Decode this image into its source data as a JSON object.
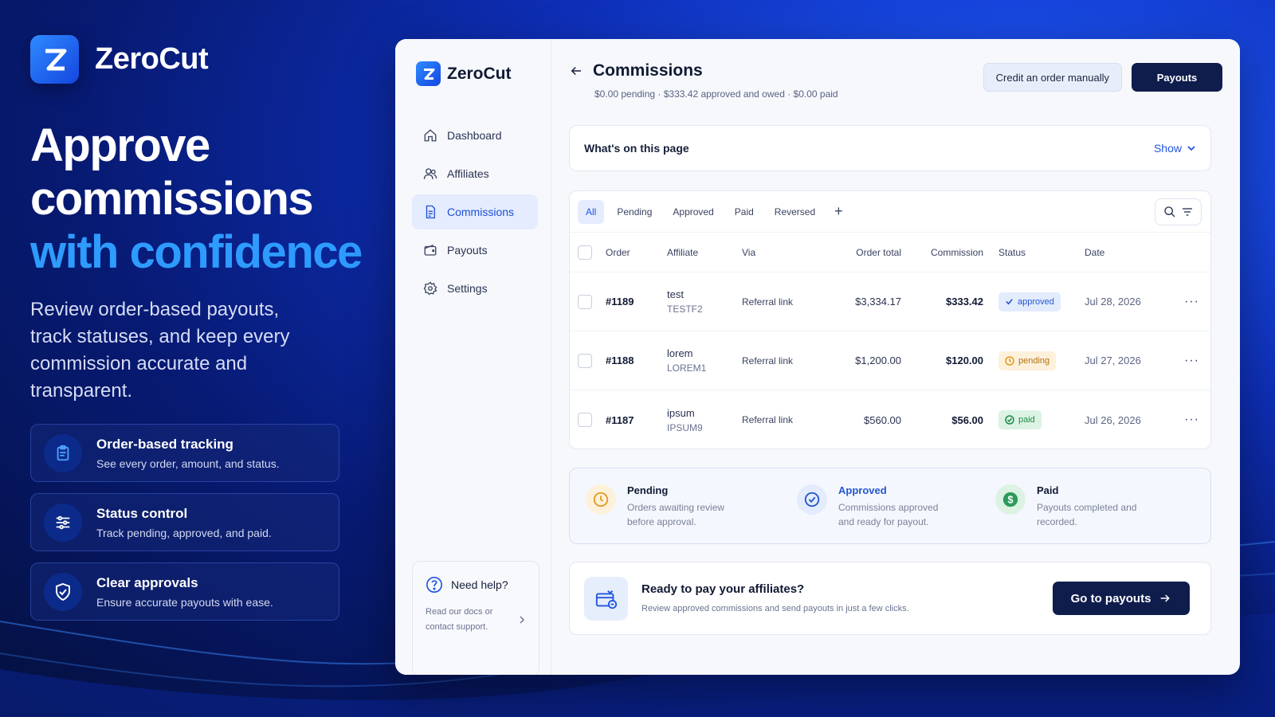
{
  "brand": {
    "name": "ZeroCut"
  },
  "hero": {
    "headline_line1": "Approve",
    "headline_line2": "commissions",
    "headline_highlight": "with confidence",
    "subtext": "Review order-based payouts, track statuses, and keep every commission accurate and transparent."
  },
  "features": [
    {
      "icon": "clipboard-icon",
      "title": "Order-based tracking",
      "desc": "See every order, amount, and status."
    },
    {
      "icon": "sliders-icon",
      "title": "Status control",
      "desc": "Track pending, approved, and paid."
    },
    {
      "icon": "shield-check-icon",
      "title": "Clear approvals",
      "desc": "Ensure accurate payouts with ease."
    }
  ],
  "sidebar": {
    "brand": "ZeroCut",
    "items": [
      {
        "label": "Dashboard",
        "icon": "home-icon",
        "active": false
      },
      {
        "label": "Affiliates",
        "icon": "users-icon",
        "active": false
      },
      {
        "label": "Commissions",
        "icon": "document-icon",
        "active": true
      },
      {
        "label": "Payouts",
        "icon": "wallet-icon",
        "active": false
      },
      {
        "label": "Settings",
        "icon": "gear-icon",
        "active": false
      }
    ],
    "help": {
      "title": "Need help?",
      "body": "Read our docs or contact support."
    }
  },
  "header": {
    "title": "Commissions",
    "summary": "$0.00 pending · $333.42 approved and owed · $0.00 paid",
    "credit_label": "Credit an order manually",
    "payouts_label": "Payouts"
  },
  "info": {
    "title": "What's on this page",
    "show_label": "Show"
  },
  "tabs": [
    "All",
    "Pending",
    "Approved",
    "Paid",
    "Reversed"
  ],
  "table": {
    "columns": {
      "order": "Order",
      "affiliate": "Affiliate",
      "via": "Via",
      "total": "Order total",
      "commission": "Commission",
      "status": "Status",
      "date": "Date"
    },
    "rows": [
      {
        "order": "#1189",
        "affiliate": "test",
        "code": "TESTF2",
        "via": "Referral link",
        "total": "$3,334.17",
        "commission": "$333.42",
        "status": "approved",
        "date": "Jul 28, 2026"
      },
      {
        "order": "#1188",
        "affiliate": "lorem",
        "code": "LOREM1",
        "via": "Referral link",
        "total": "$1,200.00",
        "commission": "$120.00",
        "status": "pending",
        "date": "Jul 27, 2026"
      },
      {
        "order": "#1187",
        "affiliate": "ipsum",
        "code": "IPSUM9",
        "via": "Referral link",
        "total": "$560.00",
        "commission": "$56.00",
        "status": "paid",
        "date": "Jul 26, 2026"
      }
    ]
  },
  "legend": [
    {
      "title": "Pending",
      "desc": "Orders awaiting review before approval.",
      "color": "#e39a1c"
    },
    {
      "title": "Approved",
      "desc": "Commissions approved and ready for payout.",
      "color": "#2456cf"
    },
    {
      "title": "Paid",
      "desc": "Payouts completed and recorded.",
      "color": "#1f8a4a"
    }
  ],
  "cta": {
    "title": "Ready to pay your affiliates?",
    "desc": "Review approved commissions and send payouts in just a few clicks.",
    "button": "Go to payouts"
  },
  "colors": {
    "accent": "#1f55e0",
    "dark": "#0f1d4d",
    "highlight": "#2e9bff"
  }
}
